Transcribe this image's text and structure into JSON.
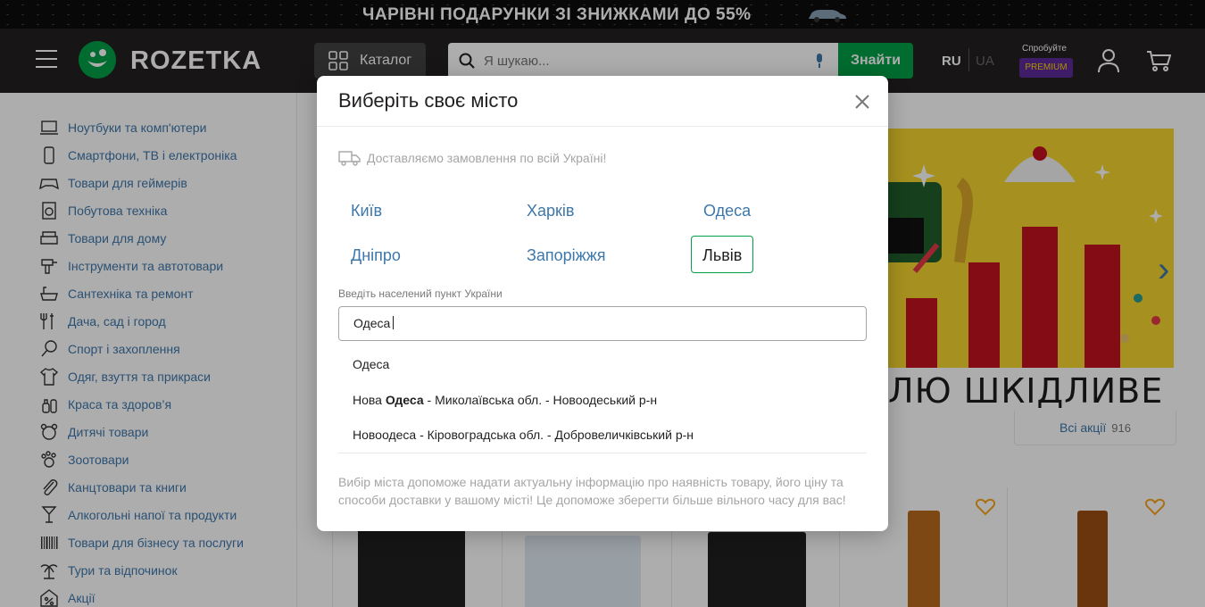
{
  "promo_banner": {
    "text": "ЧАРІВНІ ПОДАРУНКИ ЗІ ЗНИЖКАМИ ДО 55%"
  },
  "header": {
    "logo": "ROZETKA",
    "catalog_label": "Каталог",
    "search_placeholder": "Я шукаю...",
    "search_button": "Знайти",
    "lang_ru": "RU",
    "lang_ua": "UA",
    "premium_hint": "Спробуйте",
    "premium_badge": "PREMIUM"
  },
  "sidebar": {
    "items": [
      {
        "label": "Ноутбуки та комп'ютери",
        "icon": "laptop-icon"
      },
      {
        "label": "Смартфони, ТВ і електроніка",
        "icon": "phone-icon"
      },
      {
        "label": "Товари для геймерів",
        "icon": "gamepad-icon"
      },
      {
        "label": "Побутова техніка",
        "icon": "washer-icon"
      },
      {
        "label": "Товари для дому",
        "icon": "armchair-icon"
      },
      {
        "label": "Інструменти та автотовари",
        "icon": "drill-icon"
      },
      {
        "label": "Сантехніка та ремонт",
        "icon": "bathtub-icon"
      },
      {
        "label": "Дача, сад і город",
        "icon": "garden-icon"
      },
      {
        "label": "Спорт і захоплення",
        "icon": "sport-icon"
      },
      {
        "label": "Одяг, взуття та прикраси",
        "icon": "shirt-icon"
      },
      {
        "label": "Краса та здоров’я",
        "icon": "beauty-icon"
      },
      {
        "label": "Дитячі товари",
        "icon": "teddy-bear-icon"
      },
      {
        "label": "Зоотовари",
        "icon": "paw-icon"
      },
      {
        "label": "Канцтовари та книги",
        "icon": "paperclip-icon"
      },
      {
        "label": "Алкогольні напої та продукти",
        "icon": "glass-icon"
      },
      {
        "label": "Товари для бізнесу та послуги",
        "icon": "barcode-icon"
      },
      {
        "label": "Тури та відпочинок",
        "icon": "palm-icon"
      },
      {
        "label": "Акції",
        "icon": "percent-icon"
      }
    ]
  },
  "banner": {
    "text": "ЛЮ ШКІДЛИВЕ ДЛЯ ВАШО"
  },
  "promotions": {
    "all_label": "Всі акції",
    "count": "916"
  },
  "modal": {
    "title": "Виберіть своє місто",
    "delivery_text": "Доставляємо замовлення по всій Україні!",
    "cities": [
      {
        "name": "Київ",
        "active": false
      },
      {
        "name": "Харків",
        "active": false
      },
      {
        "name": "Одеса",
        "active": false
      },
      {
        "name": "Дніпро",
        "active": false
      },
      {
        "name": "Запоріжжя",
        "active": false
      },
      {
        "name": "Львів",
        "active": true
      }
    ],
    "input_label": "Введіть населений пункт України",
    "input_value": "Одеса",
    "suggestions": [
      {
        "prefix": "",
        "bold": "",
        "text": "Одеса"
      },
      {
        "prefix": "Нова ",
        "bold": "Одеса",
        "text": " - Миколаївська обл. - Новоодеський р-н"
      },
      {
        "prefix": "",
        "bold": "",
        "text": "Новоодеса - Кіровоградська обл. - Доброс величківський р-н"
      }
    ],
    "note": "Вибір міста допоможе надати актуальну інформацію про наявність товару, його ціну та способи доставки у вашому місті! Це допоможе зберегти більше вільного часу для вас!"
  },
  "colors": {
    "brand_green": "#00a046",
    "link_blue": "#3e77aa",
    "header_dark": "#221f1f",
    "premium_purple": "#5e2a98",
    "heart_orange": "#f8a41c"
  }
}
